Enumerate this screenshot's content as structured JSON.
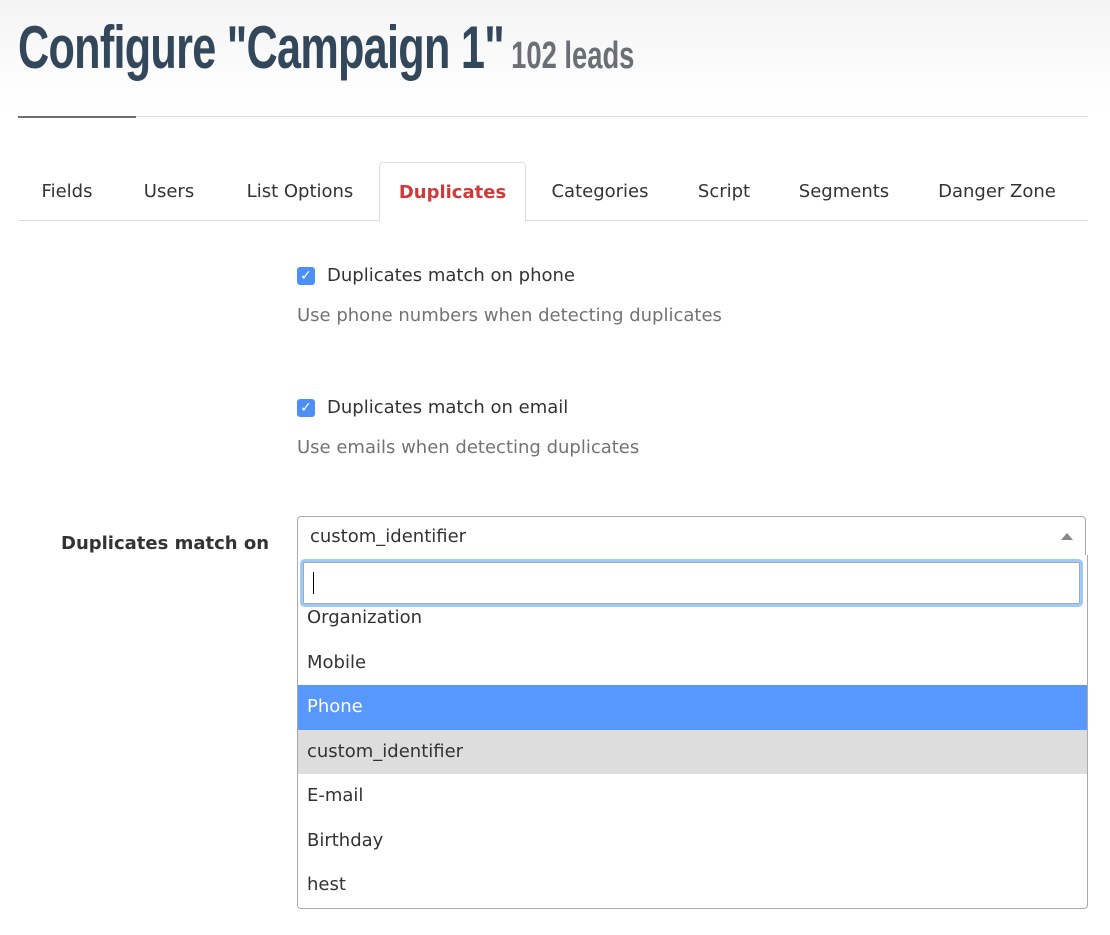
{
  "header": {
    "title": "Configure \"Campaign 1\"",
    "lead_count": "102 leads"
  },
  "tabs": [
    {
      "label": "Fields",
      "active": false
    },
    {
      "label": "Users",
      "active": false
    },
    {
      "label": "List Options",
      "active": false
    },
    {
      "label": "Duplicates",
      "active": true
    },
    {
      "label": "Categories",
      "active": false
    },
    {
      "label": "Script",
      "active": false
    },
    {
      "label": "Segments",
      "active": false
    },
    {
      "label": "Danger Zone",
      "active": false
    }
  ],
  "settings": {
    "phone_match": {
      "checked": true,
      "label": "Duplicates match on phone",
      "help": "Use phone numbers when detecting duplicates"
    },
    "email_match": {
      "checked": true,
      "label": "Duplicates match on email",
      "help": "Use emails when detecting duplicates"
    },
    "match_on": {
      "label": "Duplicates match on",
      "value": "custom_identifier",
      "search_value": "",
      "options": [
        {
          "label": "Organization",
          "state": "normal"
        },
        {
          "label": "Mobile",
          "state": "normal"
        },
        {
          "label": "Phone",
          "state": "highlighted"
        },
        {
          "label": "custom_identifier",
          "state": "selected"
        },
        {
          "label": "E-mail",
          "state": "normal"
        },
        {
          "label": "Birthday",
          "state": "normal"
        },
        {
          "label": "hest",
          "state": "normal"
        }
      ]
    }
  },
  "icons": {
    "checkbox_checked": "check-icon",
    "select_arrow": "chevron-up-icon"
  },
  "colors": {
    "accent": "#d0393a",
    "title": "#33475b",
    "checkbox": "#4c8ff7",
    "option_highlight": "#5897fb",
    "option_selected": "#dddddd"
  }
}
